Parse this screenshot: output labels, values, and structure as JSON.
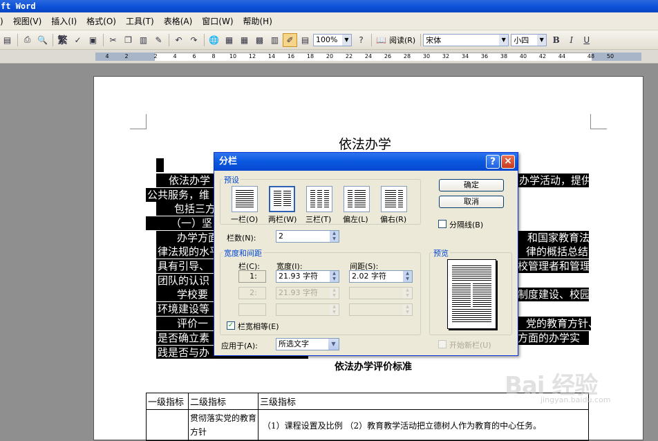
{
  "window": {
    "title": "ft Word"
  },
  "menu": [
    ") ",
    "视图(V)",
    "插入(I)",
    "格式(O)",
    "工具(T)",
    "表格(A)",
    "窗口(W)",
    "帮助(H)"
  ],
  "toolbar": {
    "traditional_label": "繁",
    "zoom": "100%",
    "read_label": "阅读(R)",
    "font": "宋体",
    "size": "小四",
    "bold": "B",
    "italic": "I"
  },
  "ruler_ticks": [
    "4",
    "2",
    "2",
    "4",
    "6",
    "8",
    "10",
    "12",
    "14",
    "16",
    "18",
    "20",
    "22",
    "24",
    "26",
    "28",
    "30",
    "32",
    "34",
    "36",
    "38",
    "40",
    "42",
    "44",
    "48",
    "50"
  ],
  "document": {
    "title": "依法办学",
    "lines": [
      "依法办学",
      "公共服务，维",
      "包括三方",
      "（一）坚",
      "办学方面",
      "律法规的水平",
      "具有引导、",
      "团队的认识",
      "学校要",
      "环境建设等",
      "评价一",
      "是否确立素",
      "践是否与办"
    ],
    "right_lines": [
      "办学活动，提供",
      "和国家教育法",
      "律的概括总结，",
      "校管理者和管理",
      "制度建设、校园",
      "党的教育方针、",
      "方面的办学实"
    ],
    "subtitle": "依法办学评价标准",
    "table": {
      "headers": [
        "一级指标",
        "二级指标",
        "三级指标"
      ],
      "row1_col2": "贯彻落实党的教育方针",
      "row1_col3": "（1）课程设置及比例  （2）教育教学活动把立德树人作为教育的中心任务。"
    },
    "watermark": "Bai 经验",
    "watermark_sub": "jingyan.baidu.com"
  },
  "dialog": {
    "title": "分栏",
    "help": "?",
    "close": "×",
    "presets_label": "预设",
    "presets": [
      "一栏(O)",
      "两栏(W)",
      "三栏(T)",
      "偏左(L)",
      "偏右(R)"
    ],
    "ok": "确定",
    "cancel": "取消",
    "divider_label": "分隔线(B)",
    "columns_label": "栏数(N):",
    "columns_value": "2",
    "width_spacing_label": "宽度和间距",
    "col_header": "栏(C):",
    "width_header": "宽度(I):",
    "spacing_header": "间距(S):",
    "row1_col": "1:",
    "row1_width": "21.93 字符",
    "row1_spacing": "2.02 字符",
    "row2_col": "2:",
    "row2_width": "21.93 字符",
    "equal_width_label": "栏宽相等(E)",
    "apply_label": "应用于(A):",
    "apply_value": "所选文字",
    "preview_label": "预览",
    "new_column_label": "开始新栏(U)"
  }
}
